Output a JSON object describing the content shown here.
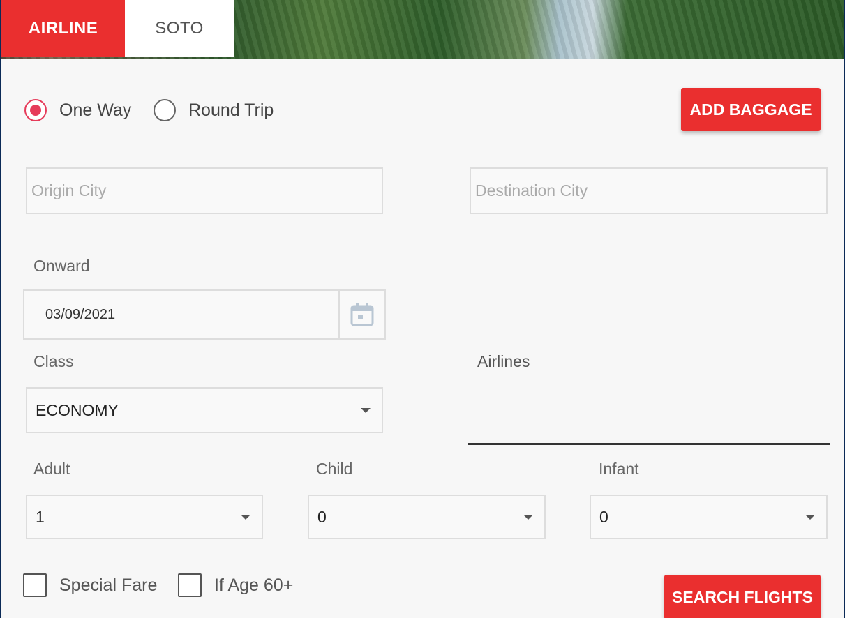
{
  "tabs": {
    "airline": "AIRLINE",
    "soto": "SOTO"
  },
  "trip_type": {
    "one_way": "One Way",
    "round_trip": "Round Trip",
    "selected": "One Way"
  },
  "buttons": {
    "add_baggage": "ADD BAGGAGE",
    "search_flights": "SEARCH FLIGHTS"
  },
  "origin": {
    "placeholder": "Origin City",
    "value": ""
  },
  "destination": {
    "placeholder": "Destination City",
    "value": ""
  },
  "onward": {
    "label": "Onward",
    "value": "03/09/2021"
  },
  "class_field": {
    "label": "Class",
    "value": "ECONOMY"
  },
  "airlines": {
    "label": "Airlines",
    "value": ""
  },
  "passengers": {
    "adult_label": "Adult",
    "adult_value": "1",
    "child_label": "Child",
    "child_value": "0",
    "infant_label": "Infant",
    "infant_value": "0"
  },
  "options": {
    "special_fare": "Special Fare",
    "senior": "If Age 60+"
  },
  "icons": {
    "calendar": "calendar-icon",
    "caret": "chevron-down-icon"
  },
  "colors": {
    "accent": "#ea2f2f",
    "radio_checked": "#e63b5a",
    "frame": "#0b2a57"
  }
}
